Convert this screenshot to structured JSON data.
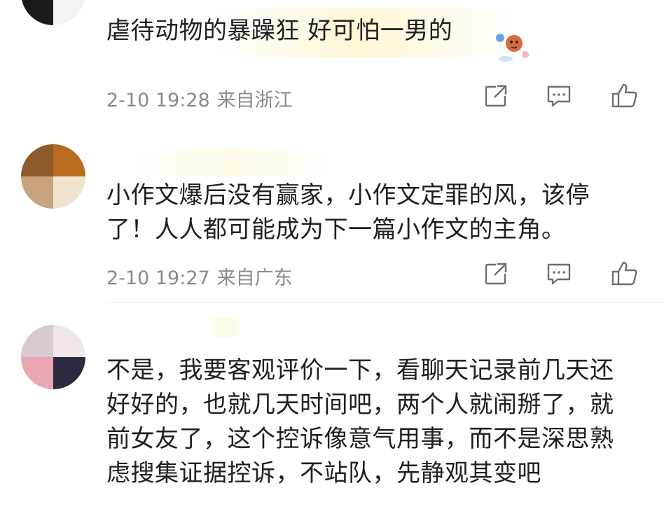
{
  "comments": [
    {
      "text": "虐待动物的暴躁狂 好可怕一男的",
      "time": "2-10 19:28",
      "location": "来自浙江",
      "avatar_colors": [
        "#2b1f26",
        "#2f4fb0",
        "#1b1b1b",
        "#f2f2f2"
      ]
    },
    {
      "text": "小作文爆后没有赢家，小作文定罪的风，该停了！人人都可能成为下一篇小作文的主角。",
      "time": "2-10 19:27",
      "location": "来自广东",
      "avatar_colors": [
        "#8e5a2c",
        "#b66b1f",
        "#c9a37e",
        "#efe4cf"
      ]
    },
    {
      "text": "不是，我要客观评价一下，看聊天记录前几天还好好的，也就几天时间吧，两个人就闹掰了，就前女友了，这个控诉像意气用事，而不是深思熟虑搜集证据控诉，不站队，先静观其变吧",
      "avatar_colors": [
        "#d9c9d0",
        "#efe6ea",
        "#e9a6b3",
        "#2c2a3e"
      ]
    }
  ],
  "icons": {
    "share": "share-icon",
    "reply": "comment-icon",
    "like": "thumbs-up-icon"
  },
  "colors": {
    "text": "#1f1f1f",
    "meta": "#8a8a8a",
    "icon": "#6e6e6e"
  }
}
